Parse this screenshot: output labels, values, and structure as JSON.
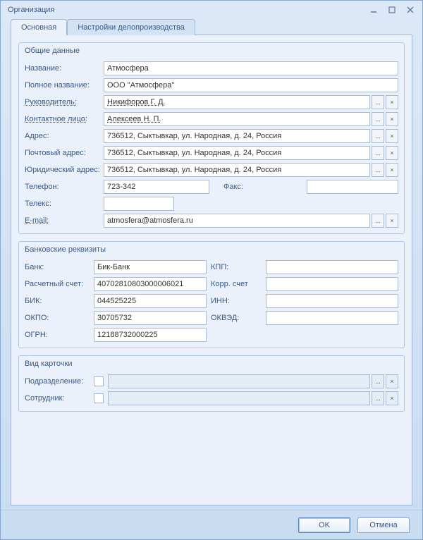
{
  "window": {
    "title": "Организация"
  },
  "tabs": [
    {
      "label": "Основная",
      "active": true
    },
    {
      "label": "Настройки делопроизводства",
      "active": false
    }
  ],
  "groups": {
    "general": {
      "title": "Общие данные",
      "fields": {
        "name_label": "Название:",
        "name_value": "Атмосфера",
        "fullname_label": "Полное название:",
        "fullname_value": "ООО \"Атмосфера\"",
        "head_label": "Руководитель:",
        "head_value": "Никифоров Г. Д.",
        "contact_label": "Контактное лицо:",
        "contact_value": "Алексеев Н. П.",
        "address_label": "Адрес:",
        "address_value": "736512, Сыктывкар, ул. Народная, д. 24, Россия",
        "post_addr_label": "Почтовый адрес:",
        "post_addr_value": "736512, Сыктывкар, ул. Народная, д. 24, Россия",
        "legal_addr_label": "Юридический адрес:",
        "legal_addr_value": "736512, Сыктывкар, ул. Народная, д. 24, Россия",
        "phone_label": "Телефон:",
        "phone_value": "723-342",
        "fax_label": "Факс:",
        "fax_value": "",
        "telex_label": "Телекс:",
        "telex_value": "",
        "email_label": "E-mail:",
        "email_value": "atmosfera@atmosfera.ru"
      }
    },
    "bank": {
      "title": "Банковские реквизиты",
      "fields": {
        "bank_label": "Банк:",
        "bank_value": "Бик-Банк",
        "kpp_label": "КПП:",
        "kpp_value": "",
        "acc_label": "Расчетный счет:",
        "acc_value": "40702810803000006021",
        "corr_label": "Корр. счет",
        "corr_value": "",
        "bik_label": "БИК:",
        "bik_value": "044525225",
        "inn_label": "ИНН:",
        "inn_value": "",
        "okpo_label": "ОКПО:",
        "okpo_value": "30705732",
        "okved_label": "ОКВЭД:",
        "okved_value": "",
        "ogrn_label": "ОГРН:",
        "ogrn_value": "12188732000225"
      }
    },
    "card": {
      "title": "Вид карточки",
      "fields": {
        "dept_label": "Подразделение:",
        "dept_value": "",
        "emp_label": "Сотрудник:",
        "emp_value": ""
      }
    }
  },
  "buttons": {
    "ok": "OK",
    "cancel": "Отмена"
  },
  "icons": {
    "ellipsis": "...",
    "clear": "×"
  }
}
